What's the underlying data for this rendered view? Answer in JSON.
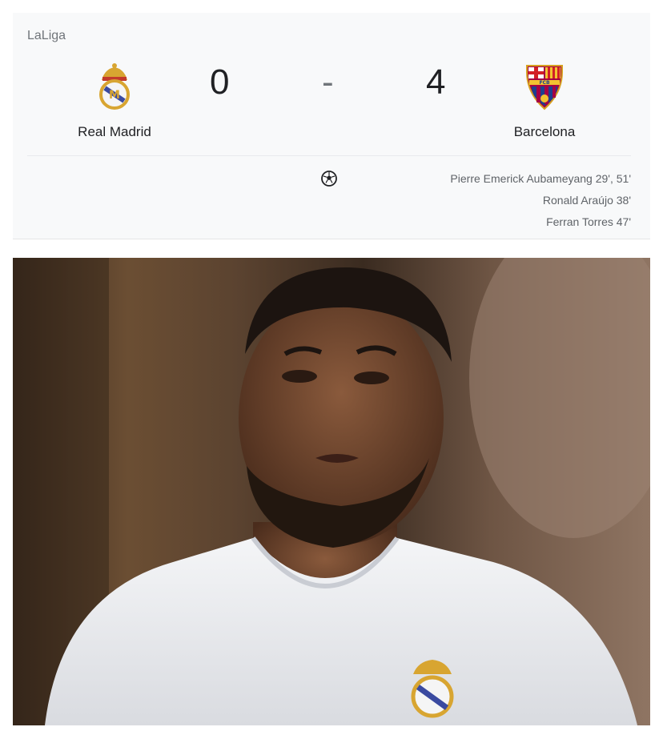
{
  "match": {
    "league": "LaLiga",
    "home_team": "Real Madrid",
    "away_team": "Barcelona",
    "home_score": "0",
    "separator": "-",
    "away_score": "4"
  },
  "scorers": [
    "Pierre Emerick Aubameyang 29', 51'",
    "Ronald Araújo 38'",
    "Ferran Torres 47'"
  ],
  "colors": {
    "card_bg": "#f8f9fa",
    "madrid_gold": "#d8a531",
    "barca_blue": "#1d3f8e",
    "barca_red": "#a50044",
    "barca_yellow": "#f2c230"
  },
  "icons": [
    "real-madrid-crest",
    "barcelona-crest",
    "soccer-ball-icon"
  ]
}
